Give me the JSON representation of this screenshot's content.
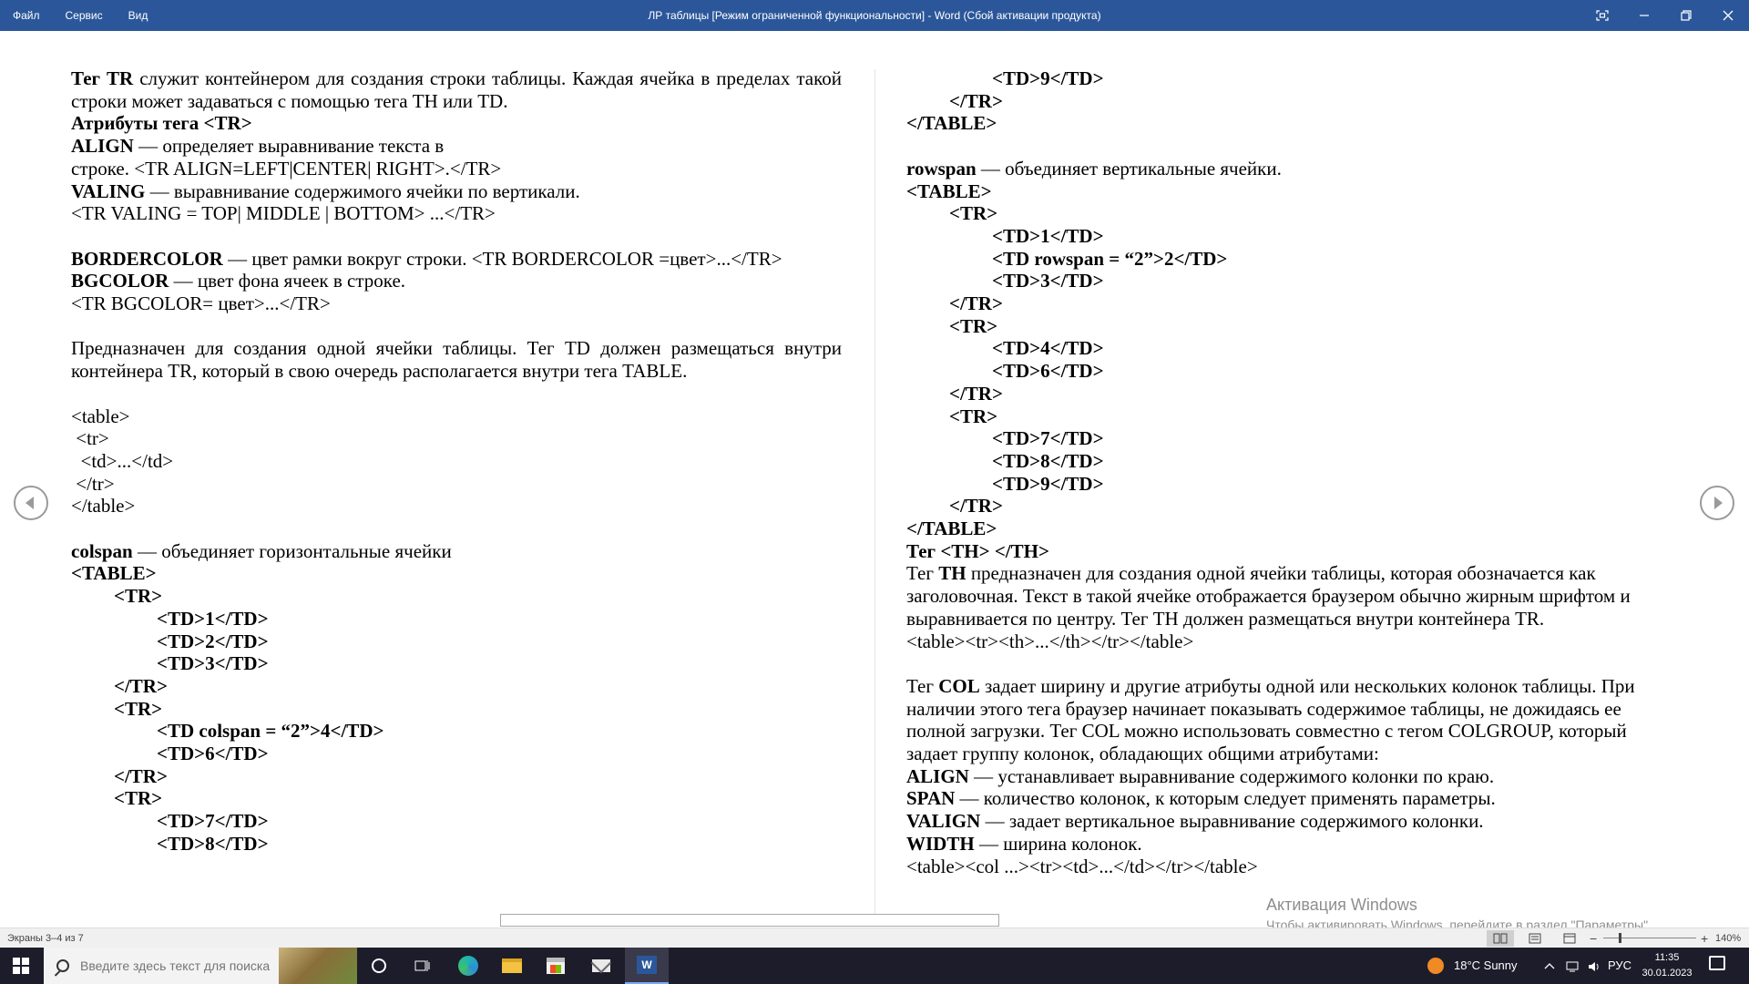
{
  "titlebar": {
    "menu": [
      "Файл",
      "Сервис",
      "Вид"
    ],
    "title": "ЛР  таблицы [Режим ограниченной функциональности] - Word (Сбой активации продукта)",
    "controls": [
      "focus-icon",
      "minimize-icon",
      "restore-icon",
      "close-icon"
    ],
    "bg_color": "#2b579a"
  },
  "left_column": [
    [
      "Тег TR",
      " служит контейнером для создания строки таблицы. Каждая ячейка в пределах такой строки может задаваться с помощью тега TH или TD."
    ],
    [
      "Атрибуты тега <TR>",
      ""
    ],
    [
      "ALIGN",
      " — определяет выравнивание текста в"
    ],
    [
      "",
      "строке. <TR ALIGN=LEFT|CENTER| RIGHT>.</TR>"
    ],
    [
      "VALING",
      " — выравнивание содержимого ячейки по вертикали."
    ],
    [
      "",
      "<TR VALING = TOP| MIDDLE | BOTTOM> ...</TR>"
    ],
    [
      "",
      ""
    ],
    [
      "BORDERCOLOR",
      " — цвет рамки вокруг строки. <TR BORDERCOLOR =цвет>...</TR>"
    ],
    [
      "BGCOLOR",
      " — цвет фона ячеек в строке."
    ],
    [
      "",
      "<TR BGCOLOR= цвет>...</TR>"
    ],
    [
      "",
      ""
    ],
    [
      "",
      "Предназначен для создания одной ячейки таблицы. Тег TD должен размещаться внутри контейнера TR, который в свою очередь располагается внутри тега TABLE."
    ],
    [
      "",
      ""
    ],
    [
      "",
      "<table>"
    ],
    [
      "",
      " <tr>"
    ],
    [
      "",
      "  <td>...</td>"
    ],
    [
      "",
      " </tr>"
    ],
    [
      "",
      "</table>"
    ],
    [
      "",
      ""
    ],
    [
      "colspan",
      " — объединяет горизонтальные ячейки"
    ],
    [
      "<TABLE>",
      ""
    ],
    [
      "<TR>",
      ""
    ],
    [
      "<TD>1</TD>",
      ""
    ],
    [
      "<TD>2</TD>",
      ""
    ],
    [
      "<TD>3</TD>",
      ""
    ],
    [
      "</TR>",
      ""
    ],
    [
      "<TR>",
      ""
    ],
    [
      "<TD colspan = “2”>4</TD>",
      ""
    ],
    [
      "<TD>6</TD>",
      ""
    ],
    [
      "</TR>",
      ""
    ],
    [
      "<TR>",
      ""
    ],
    [
      "<TD>7</TD>",
      ""
    ],
    [
      "<TD>8</TD>",
      ""
    ]
  ],
  "right_column": [
    [
      "<TD>9</TD>",
      ""
    ],
    [
      "</TR>",
      ""
    ],
    [
      "</TABLE>",
      ""
    ],
    [
      "",
      ""
    ],
    [
      "rowspan",
      " — объединяет вертикальные ячейки."
    ],
    [
      "<TABLE>",
      ""
    ],
    [
      "<TR>",
      ""
    ],
    [
      "<TD>1</TD>",
      ""
    ],
    [
      "<TD rowspan = “2”>2</TD>",
      ""
    ],
    [
      "<TD>3</TD>",
      ""
    ],
    [
      "</TR>",
      ""
    ],
    [
      "<TR>",
      ""
    ],
    [
      "<TD>4</TD>",
      ""
    ],
    [
      "<TD>6</TD>",
      ""
    ],
    [
      "</TR>",
      ""
    ],
    [
      "<TR>",
      ""
    ],
    [
      "<TD>7</TD>",
      ""
    ],
    [
      "<TD>8</TD>",
      ""
    ],
    [
      "<TD>9</TD>",
      ""
    ],
    [
      "</TR>",
      ""
    ],
    [
      "</TABLE>",
      ""
    ],
    [
      "Тег <TH> </TH>",
      ""
    ],
    [
      "Тег ",
      "TH",
      " предназначен для создания одной ячейки таблицы, которая обозначается как заголовочная. Текст в такой ячейке отображается браузером обычно жирным шрифтом и выравнивается по центру. Тег TH должен размещаться внутри контейнера TR."
    ],
    [
      "",
      "<table><tr><th>...</th></tr></table>"
    ],
    [
      "",
      ""
    ],
    [
      "Тег ",
      "COL",
      " задает ширину и другие атрибуты одной или нескольких колонок таблицы. При наличии этого тега браузер начинает показывать содержимое таблицы, не дожидаясь ее полной загрузки. Тег COL можно использовать совместно с тегом COLGROUP, который задает группу колонок, обладающих общими атрибутами:"
    ],
    [
      "ALIGN",
      " — устанавливает выравнивание содержимого колонки по краю."
    ],
    [
      "SPAN",
      " — количество колонок, к которым следует применять параметры."
    ],
    [
      "VALIGN",
      " — задает вертикальное выравнивание содержимого колонки."
    ],
    [
      "WIDTH",
      " — ширина колонок."
    ],
    [
      "",
      "<table><col ...><tr><td>...</td></tr></table>"
    ]
  ],
  "left": {
    "p0_b": "Тег TR",
    "p0_t": " служит контейнером для создания строки таблицы. Каждая ячейка в пределах такой строки может задаваться с помощью тега TH или TD.",
    "p1_b": "Атрибуты тега <TR>",
    "p2_b": "ALIGN",
    "p2_t": " — определяет выравнивание текста в",
    "p3_t": "строке. <TR ALIGN=LEFT|CENTER| RIGHT>.</TR>",
    "p4_b": "VALING",
    "p4_t": " — выравнивание содержимого ячейки по вертикали.",
    "p5_t": "<TR VALING = TOP| MIDDLE | BOTTOM> ...</TR>",
    "p7_b": "BORDERCOLOR",
    "p7_t": " — цвет рамки вокруг строки. <TR BORDERCOLOR =цвет>...</TR>",
    "p8_b": "BGCOLOR",
    "p8_t": " — цвет фона ячеек в строке.",
    "p9_t": "<TR BGCOLOR= цвет>...</TR>",
    "p11_t": "Предназначен для создания одной ячейки таблицы. Тег TD должен размещаться внутри контейнера TR, который в свою очередь располагается внутри тега TABLE.",
    "c1": "<table>",
    "c2": " <tr>",
    "c3": "  <td>...</td>",
    "c4": " </tr>",
    "c5": "</table>",
    "p19_b": "colspan",
    "p19_t": " — объединяет горизонтальные ячейки",
    "k1": "<TABLE>",
    "k2": "<TR>",
    "k3": "<TD>1</TD>",
    "k4": "<TD>2</TD>",
    "k5": "<TD>3</TD>",
    "k6": "</TR>",
    "k7": "<TR>",
    "k8": "<TD colspan = “2”>4</TD>",
    "k9": "<TD>6</TD>",
    "k10": "</TR>",
    "k11": "<TR>",
    "k12": "<TD>7</TD>",
    "k13": "<TD>8</TD>"
  },
  "right": {
    "k1": "<TD>9</TD>",
    "k2": "</TR>",
    "k3": "</TABLE>",
    "p4_b": "rowspan",
    "p4_t": " — объединяет вертикальные ячейки.",
    "r1": "<TABLE>",
    "r2": "<TR>",
    "r3": "<TD>1</TD>",
    "r4": "<TD rowspan = “2”>2</TD>",
    "r5": "<TD>3</TD>",
    "r6": "</TR>",
    "r7": "<TR>",
    "r8": "<TD>4</TD>",
    "r9": "<TD>6</TD>",
    "r10": "</TR>",
    "r11": "<TR>",
    "r12": "<TD>7</TD>",
    "r13": "<TD>8</TD>",
    "r14": "<TD>9</TD>",
    "r15": "</TR>",
    "r16": "</TABLE>",
    "th_head": "Тег <TH> </TH>",
    "th_a": "Тег ",
    "th_b": "TH",
    "th_t": " предназначен для создания одной ячейки таблицы, которая обозначается как заголовочная. Текст в такой ячейке отображается браузером обычно жирным шрифтом и выравнивается по центру. Тег TH должен размещаться внутри контейнера TR.",
    "th_code": "<table><tr><th>...</th></tr></table>",
    "col_a": "Тег ",
    "col_b": "COL",
    "col_t": " задает ширину и другие атрибуты одной или нескольких колонок таблицы. При наличии этого тега браузер начинает показывать содержимое таблицы, не дожидаясь ее полной загрузки. Тег COL можно использовать совместно с тегом COLGROUP, который задает группу колонок, обладающих общими атрибутами:",
    "a1_b": "ALIGN",
    "a1_t": " — устанавливает выравнивание содержимого колонки по краю.",
    "a2_b": "SPAN",
    "a2_t": " — количество колонок, к которым следует применять параметры.",
    "a3_b": "VALIGN",
    "a3_t": " — задает вертикальное выравнивание содержимого колонки.",
    "a4_b": "WIDTH",
    "a4_t": " — ширина колонок.",
    "col_code": "<table><col ...><tr><td>...</td></tr></table>"
  },
  "watermark": {
    "line1": "Активация Windows",
    "line2": "Чтобы активировать Windows, перейдите в раздел \"Параметры\"."
  },
  "statusbar": {
    "pages": "Экраны 3–4 из 7",
    "zoom_minus": "−",
    "zoom_plus": "+",
    "zoom": "140%"
  },
  "taskbar": {
    "search_placeholder": "Введите здесь текст для поиска",
    "weather": "18°C  Sunny",
    "lang": "РУС",
    "time": "11:35",
    "date": "30.01.2023"
  }
}
